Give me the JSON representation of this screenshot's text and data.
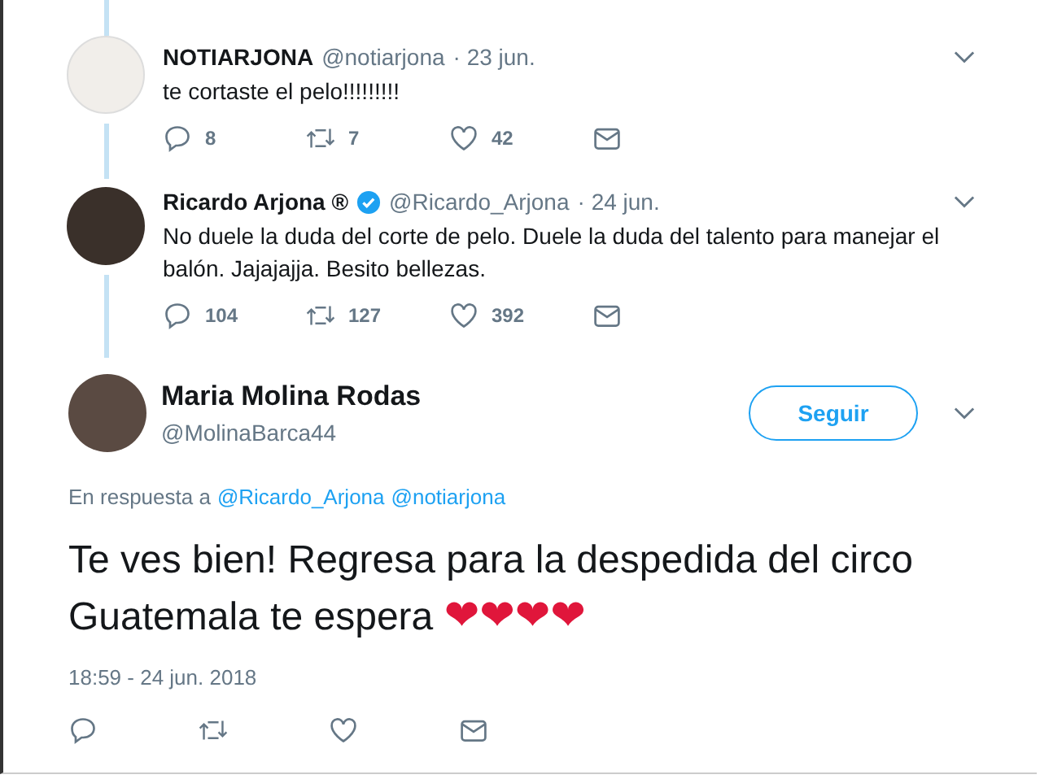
{
  "replies": [
    {
      "name": "NOTIARJONA",
      "verified": false,
      "handle": "@notiarjona",
      "date": "· 23 jun.",
      "text": "te cortaste el pelo!!!!!!!!!",
      "line_above": true,
      "line_below": true,
      "actions": [
        {
          "kind": "reply",
          "count": "8"
        },
        {
          "kind": "retweet",
          "count": "7"
        },
        {
          "kind": "like",
          "count": "42"
        },
        {
          "kind": "message"
        }
      ]
    },
    {
      "name": "Ricardo Arjona ®",
      "verified": true,
      "handle": "@Ricardo_Arjona",
      "date": "· 24 jun.",
      "text": "No duele la duda del corte de pelo.  Duele la duda del talento para manejar el balón. Jajajajja. Besito bellezas.",
      "line_above": false,
      "line_below": true,
      "actions": [
        {
          "kind": "reply",
          "count": "104"
        },
        {
          "kind": "retweet",
          "count": "127"
        },
        {
          "kind": "like",
          "count": "392"
        },
        {
          "kind": "message"
        }
      ]
    }
  ],
  "main": {
    "name": "Maria Molina Rodas",
    "handle": "@MolinaBarca44",
    "follow_button": "Seguir",
    "reply_to": "En respuesta a",
    "mentions": [
      "@Ricardo_Arjona",
      "@notiarjona"
    ],
    "text": "Te ves bien! Regresa para la despedida del circo Guatemala te espera",
    "emoji": "❤❤❤❤",
    "timestamp": "18:59 - 24 jun. 2018",
    "actions": [
      {
        "kind": "reply"
      },
      {
        "kind": "retweet"
      },
      {
        "kind": "like"
      },
      {
        "kind": "message"
      }
    ]
  }
}
